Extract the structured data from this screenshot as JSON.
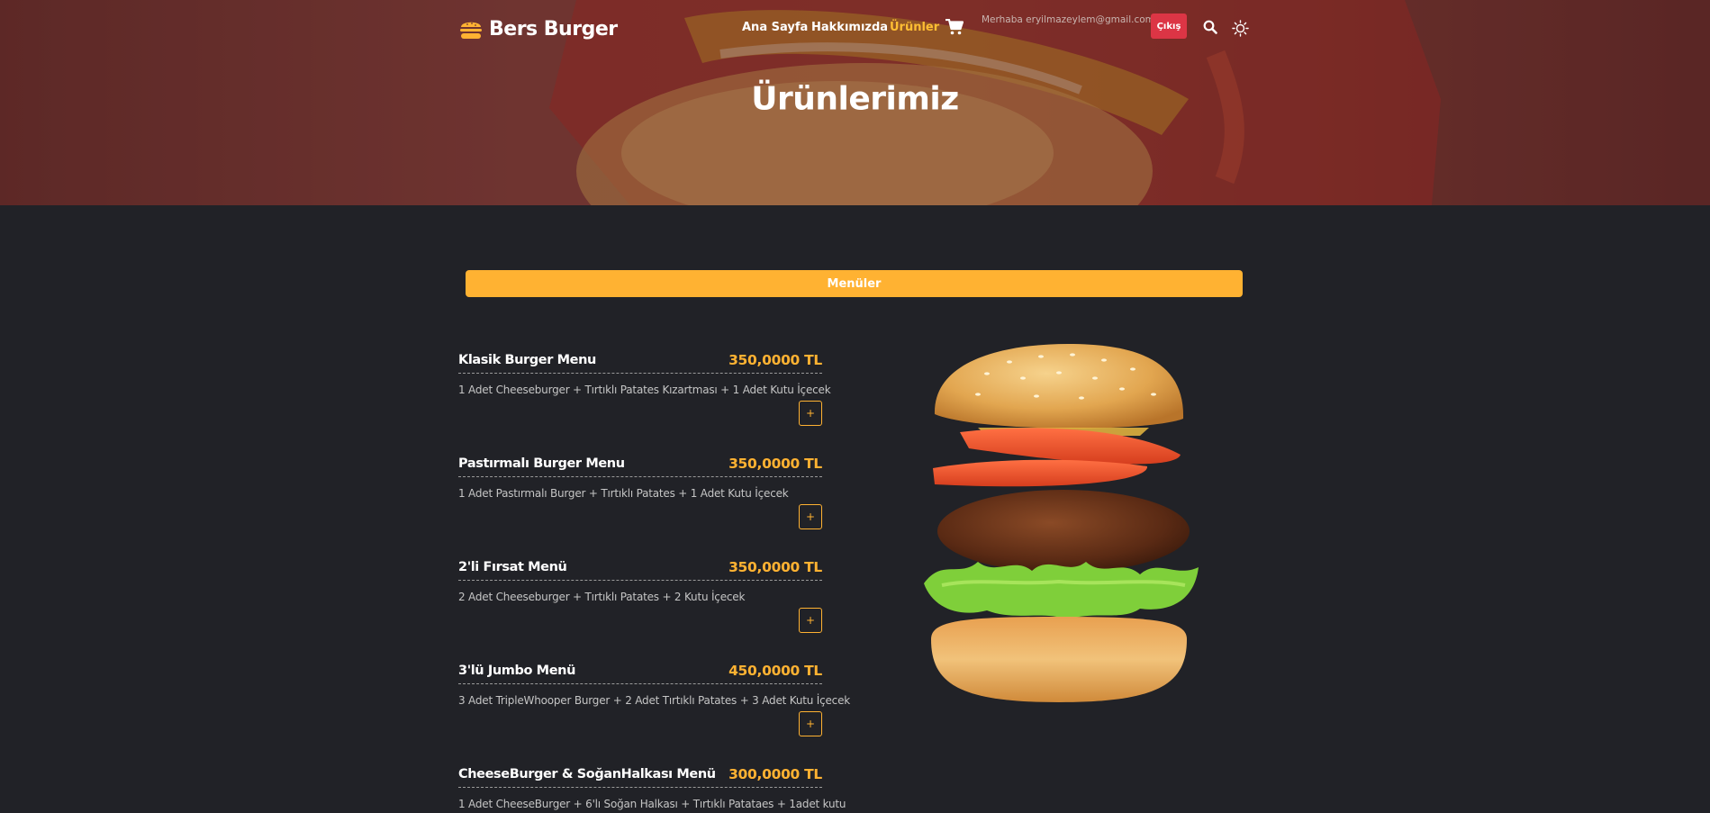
{
  "brand": {
    "name": "Bers Burger",
    "logo_icon": "burger-logo-icon"
  },
  "nav": {
    "items": [
      {
        "label": "Ana Sayfa",
        "active": false
      },
      {
        "label": "Hakkımızda",
        "active": false
      },
      {
        "label": "Ürünler",
        "active": true
      }
    ],
    "cart_icon": "cart-icon",
    "greeting": "Merhaba eryilmazeylem@gmail.com",
    "logout_label": "Çıkış",
    "search_icon": "search-icon",
    "theme_icon": "sun-icon"
  },
  "hero": {
    "title": "Ürünlerimiz"
  },
  "filters": {
    "active_label": "Menüler"
  },
  "menu_items": [
    {
      "name": "Klasik Burger Menu",
      "price": "350,0000 TL",
      "description": "1 Adet Cheeseburger + Tırtıklı Patates Kızartması + 1 Adet Kutu İçecek",
      "add_label": "+"
    },
    {
      "name": "Pastırmalı Burger Menu",
      "price": "350,0000 TL",
      "description": "1 Adet Pastırmalı Burger + Tırtıklı Patates + 1 Adet Kutu İçecek",
      "add_label": "+"
    },
    {
      "name": "2'li Fırsat Menü",
      "price": "350,0000 TL",
      "description": "2 Adet Cheeseburger + Tırtıklı Patates + 2 Kutu İçecek",
      "add_label": "+"
    },
    {
      "name": "3'lü Jumbo Menü",
      "price": "450,0000 TL",
      "description": "3 Adet TripleWhooper Burger + 2 Adet Tırtıklı Patates + 3 Adet Kutu İçecek",
      "add_label": "+"
    },
    {
      "name": "CheeseBurger & SoğanHalkası Menü",
      "price": "300,0000 TL",
      "description": "1 Adet CheeseBurger + 6'lı Soğan Halkası + Tırtıklı Patatаes + 1adet kutu",
      "add_label": "+"
    }
  ],
  "colors": {
    "accent": "#ffb232",
    "background": "#212227",
    "logout": "#dc3545"
  }
}
